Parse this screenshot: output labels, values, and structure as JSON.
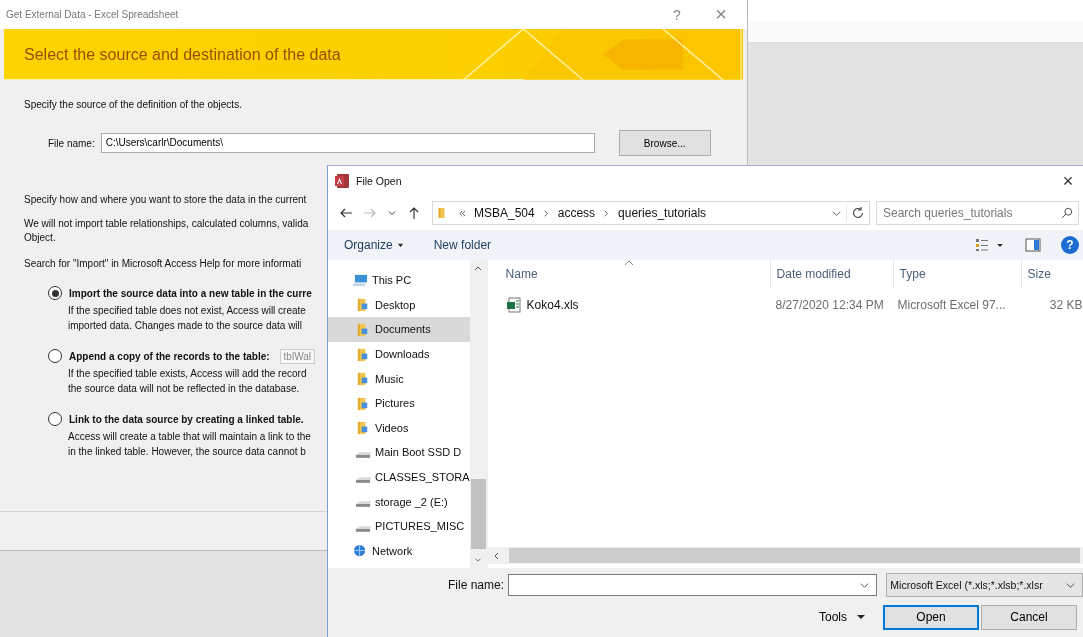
{
  "import_dialog": {
    "title": "Get External Data - Excel Spreadsheet",
    "help": "?",
    "close": "×",
    "banner_title": "Select the source and destination of the data",
    "source_prompt": "Specify the source of the definition of the objects.",
    "file_name_label": "File name:",
    "file_name_value": "C:\\Users\\carlr\\Documents\\",
    "browse_button": "Browse...",
    "store_prompt": "Specify how and where you want to store the data in the current",
    "note_lines": [
      "We will not import table relationships, calculated columns, valida",
      "Object."
    ],
    "help_hint": "Search for \"Import\" in Microsoft Access Help for more informati",
    "options": [
      {
        "label": "Import the source data into a new table in the curre",
        "selected": true,
        "description_lines": [
          "If the specified table does not exist, Access will create",
          "imported data. Changes made to the source data will"
        ]
      },
      {
        "label": "Append a copy of the records to the table:",
        "selected": false,
        "table_value": "tblWal",
        "description_lines": [
          "If the specified table exists, Access will add the record",
          "the source data will not be reflected in the database."
        ]
      },
      {
        "label": "Link to the data source by creating a linked table.",
        "selected": false,
        "description_lines": [
          "Access will create a table that will maintain a link to the",
          "in the linked table. However, the source data cannot b"
        ]
      }
    ]
  },
  "file_open": {
    "title": "File Open",
    "close": "×",
    "path": [
      "MSBA_504",
      "access",
      "queries_tutorials"
    ],
    "search": {
      "placeholder": "Search queries_tutorials"
    },
    "toolbar": {
      "organize": "Organize",
      "new_folder": "New folder",
      "help": "?"
    },
    "nav": [
      {
        "label": "This PC",
        "kind": "pc",
        "selected": false,
        "children": [
          {
            "label": "Desktop",
            "kind": "folder",
            "selected": false
          },
          {
            "label": "Documents",
            "kind": "folder",
            "selected": true
          },
          {
            "label": "Downloads",
            "kind": "folder",
            "selected": false
          },
          {
            "label": "Music",
            "kind": "folder",
            "selected": false
          },
          {
            "label": "Pictures",
            "kind": "folder",
            "selected": false
          },
          {
            "label": "Videos",
            "kind": "folder",
            "selected": false
          },
          {
            "label": "Main Boot SSD D",
            "kind": "drive",
            "selected": false
          },
          {
            "label": "CLASSES_STORA",
            "kind": "drive",
            "selected": false
          },
          {
            "label": "storage _2 (E:)",
            "kind": "drive",
            "selected": false
          },
          {
            "label": "PICTURES_MISC",
            "kind": "drive",
            "selected": false
          }
        ]
      },
      {
        "label": "Network",
        "kind": "network",
        "selected": false
      }
    ],
    "columns": [
      "Name",
      "Date modified",
      "Type",
      "Size"
    ],
    "files": [
      {
        "name": "Koko4.xls",
        "date_modified": "8/27/2020 12:34 PM",
        "type": "Microsoft Excel 97...",
        "size": "32 KB",
        "selected": false
      }
    ],
    "file_name_label": "File name:",
    "filter": "Microsoft Excel (*.xls;*.xlsb;*.xlsr",
    "tools": "Tools",
    "open_button": "Open",
    "cancel_button": "Cancel"
  }
}
